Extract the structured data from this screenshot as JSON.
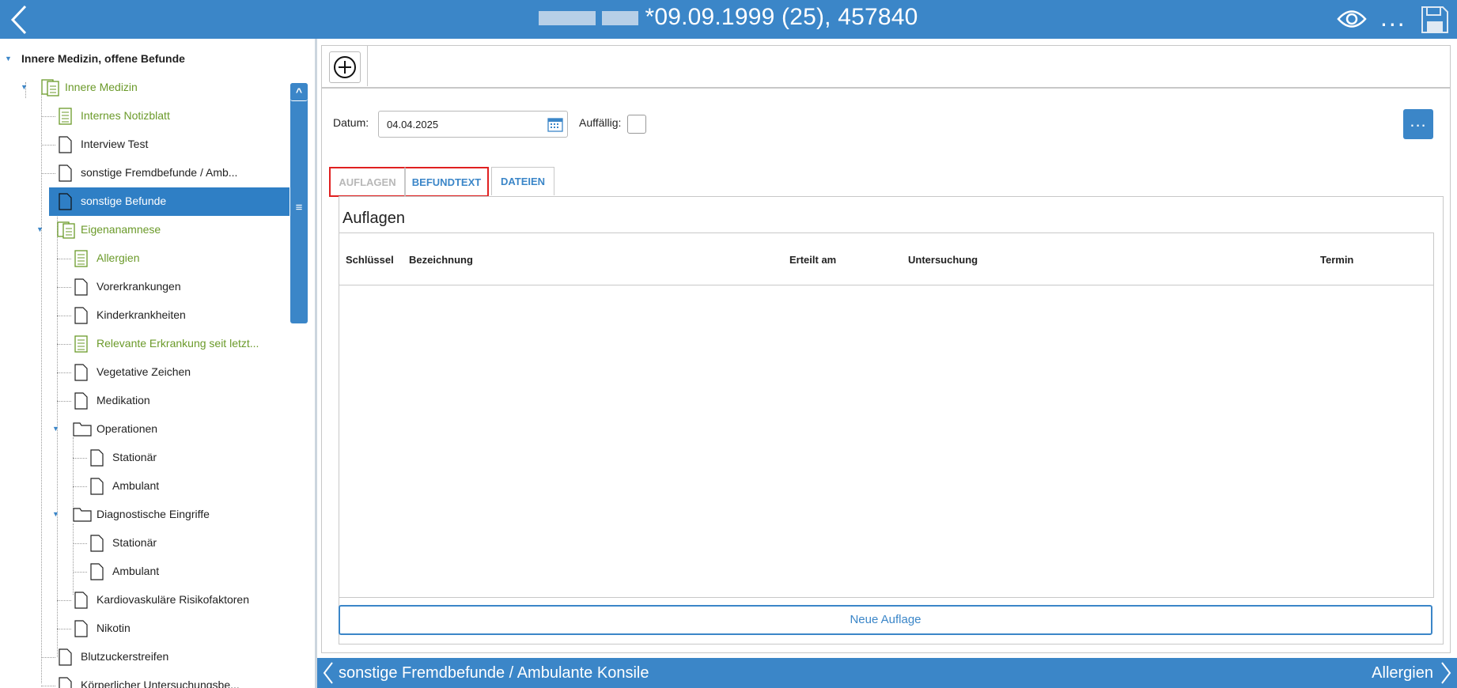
{
  "header": {
    "title": "*09.09.1999 (25), 457840",
    "more_label": "..."
  },
  "sidebar": {
    "items": [
      {
        "label": "Innere Medizin, offene Befunde"
      },
      {
        "label": "Innere Medizin"
      },
      {
        "label": "Internes Notizblatt"
      },
      {
        "label": "Interview Test"
      },
      {
        "label": "sonstige Fremdbefunde / Amb..."
      },
      {
        "label": "sonstige Befunde"
      },
      {
        "label": "Eigenanamnese"
      },
      {
        "label": "Allergien"
      },
      {
        "label": "Vorerkrankungen"
      },
      {
        "label": "Kinderkrankheiten"
      },
      {
        "label": "Relevante Erkrankung seit letzt..."
      },
      {
        "label": "Vegetative Zeichen"
      },
      {
        "label": "Medikation"
      },
      {
        "label": "Operationen"
      },
      {
        "label": "Stationär"
      },
      {
        "label": "Ambulant"
      },
      {
        "label": "Diagnostische Eingriffe"
      },
      {
        "label": "Stationär"
      },
      {
        "label": "Ambulant"
      },
      {
        "label": "Kardiovaskuläre Risikofaktoren"
      },
      {
        "label": "Nikotin"
      },
      {
        "label": "Blutzuckerstreifen"
      },
      {
        "label": "Körperlicher Untersuchungsbe..."
      }
    ],
    "scroll_up": "^",
    "scroll_down": "v",
    "scroll_grip": "≡"
  },
  "form": {
    "datum_label": "Datum:",
    "datum_value": "04.04.2025",
    "auffaellig_label": "Auffällig:",
    "more_button": "..."
  },
  "tabs": [
    {
      "label": "AUFLAGEN"
    },
    {
      "label": "BEFUNDTEXT"
    },
    {
      "label": "DATEIEN"
    }
  ],
  "panel": {
    "title": "Auflagen",
    "columns": [
      "Schlüssel",
      "Bezeichnung",
      "Erteilt am",
      "Untersuchung",
      "Termin"
    ],
    "rows": [],
    "add_button": "Neue Auflage"
  },
  "footer": {
    "prev_label": "sonstige Fremdbefunde / Ambulante Konsile",
    "next_label": "Allergien"
  },
  "colors": {
    "accent": "#3b86c8",
    "green_text": "#6b9a2a",
    "highlight_box": "#e02020"
  }
}
